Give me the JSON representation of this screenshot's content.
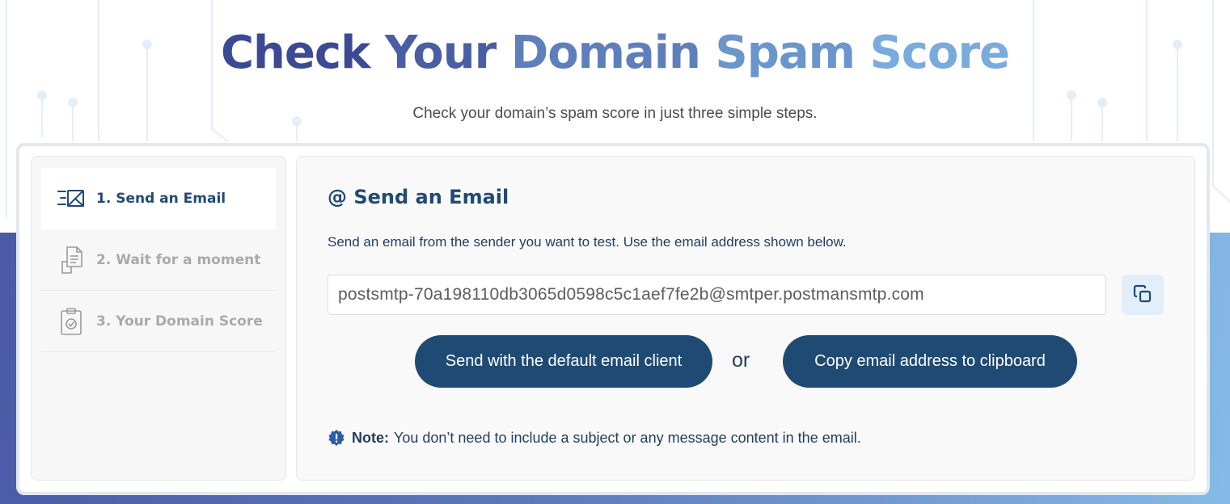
{
  "hero": {
    "title_parts": [
      "Check",
      "Your",
      "Domain",
      "Spam",
      "Score"
    ],
    "title_colors": [
      "#3c4a95",
      "#4a5ea3",
      "#5f7fbc",
      "#6b95cd",
      "#79abdc"
    ],
    "subtitle": "Check your domain’s spam score in just three simple steps."
  },
  "steps": [
    {
      "label": "1. Send an Email",
      "state": "active",
      "icon": "send-email-icon"
    },
    {
      "label": "2. Wait for a moment",
      "state": "inactive",
      "icon": "documents-icon"
    },
    {
      "label": "3. Your Domain Score",
      "state": "inactive",
      "icon": "clipboard-check-icon"
    }
  ],
  "main": {
    "title": "@ Send an Email",
    "description": "Send an email from the sender you want to test. Use the email address shown below.",
    "email_value": "postsmtp-70a198110db3065d0598c5c1aef7fe2b@smtper.postmansmtp.com",
    "copy_icon": "copy-icon",
    "send_default_label": "Send with the default email client",
    "or_text": "or",
    "copy_clipboard_label": "Copy email address to clipboard",
    "note_label": "Note:",
    "note_text": "You don’t need to include a subject or any message content in the email.",
    "note_icon": "exclamation-badge-icon"
  },
  "colors": {
    "primary": "#1f4a74",
    "accent_light": "#e2eefa",
    "gradient_start": "#4a5aa6",
    "gradient_end": "#86bbe6"
  }
}
